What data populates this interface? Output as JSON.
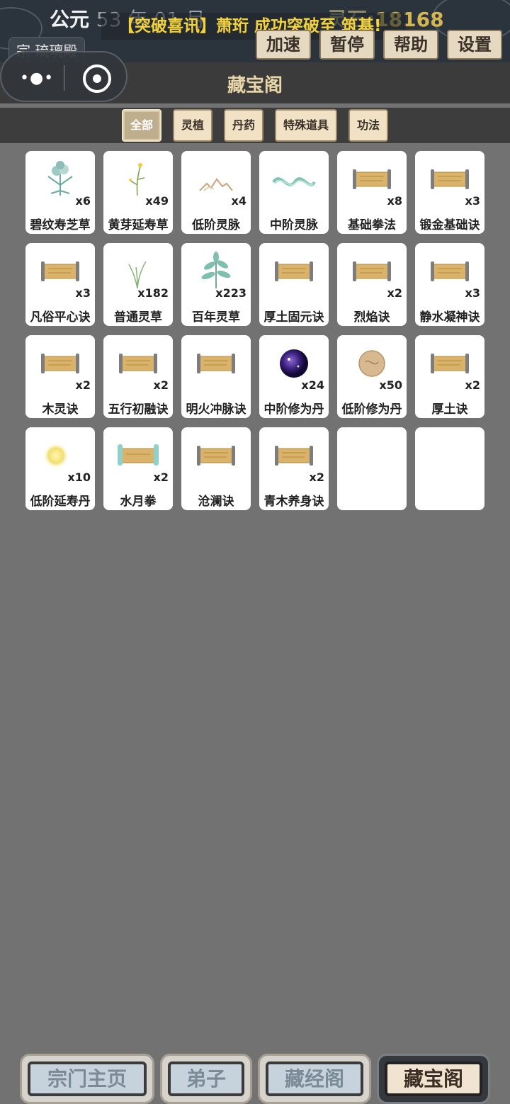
{
  "header": {
    "era_label": "公元",
    "date": "53 年 01 月",
    "stone_label": "灵石:",
    "stone_value": "18168",
    "news": "【突破喜讯】萧珩 成功突破至 筑基!",
    "buttons": [
      "加速",
      "暂停",
      "帮助",
      "设置"
    ],
    "sect": "宗 琉璃殿"
  },
  "capsule": {
    "menu_icon": "more-dots-icon",
    "close_icon": "target-circle-icon"
  },
  "page": {
    "title": "藏宝阁"
  },
  "filters": [
    {
      "label": "全部",
      "active": true
    },
    {
      "label": "灵植",
      "active": false
    },
    {
      "label": "丹药",
      "active": false
    },
    {
      "label": "特殊道具",
      "active": false
    },
    {
      "label": "功法",
      "active": false
    }
  ],
  "items": [
    {
      "name": "碧纹寿芝草",
      "qty": "x6",
      "icon": "herb-blue-icon"
    },
    {
      "name": "黄芽延寿草",
      "qty": "x49",
      "icon": "herb-yellow-icon"
    },
    {
      "name": "低阶灵脉",
      "qty": "x4",
      "icon": "mountain-vein-icon"
    },
    {
      "name": "中阶灵脉",
      "qty": "",
      "icon": "jade-vein-icon"
    },
    {
      "name": "基础拳法",
      "qty": "x8",
      "icon": "scroll-icon"
    },
    {
      "name": "锻金基础诀",
      "qty": "x3",
      "icon": "scroll-icon"
    },
    {
      "name": "凡俗平心诀",
      "qty": "x3",
      "icon": "scroll-icon"
    },
    {
      "name": "普通灵草",
      "qty": "x182",
      "icon": "grass-icon"
    },
    {
      "name": "百年灵草",
      "qty": "x223",
      "icon": "leaf-herb-icon"
    },
    {
      "name": "厚土固元诀",
      "qty": "",
      "icon": "scroll-icon"
    },
    {
      "name": "烈焰诀",
      "qty": "x2",
      "icon": "scroll-icon"
    },
    {
      "name": "静水凝神诀",
      "qty": "x3",
      "icon": "scroll-icon"
    },
    {
      "name": "木灵诀",
      "qty": "x2",
      "icon": "scroll-icon"
    },
    {
      "name": "五行初融诀",
      "qty": "x2",
      "icon": "scroll-icon"
    },
    {
      "name": "明火冲脉诀",
      "qty": "",
      "icon": "scroll-icon"
    },
    {
      "name": "中阶修为丹",
      "qty": "x24",
      "icon": "purple-pill-icon"
    },
    {
      "name": "低阶修为丹",
      "qty": "x50",
      "icon": "tan-pill-icon"
    },
    {
      "name": "厚土诀",
      "qty": "x2",
      "icon": "scroll-icon"
    },
    {
      "name": "低阶延寿丹",
      "qty": "x10",
      "icon": "glow-pill-icon"
    },
    {
      "name": "水月拳",
      "qty": "x2",
      "icon": "jade-scroll-icon"
    },
    {
      "name": "沧澜诀",
      "qty": "",
      "icon": "scroll-icon"
    },
    {
      "name": "青木养身诀",
      "qty": "x2",
      "icon": "scroll-icon"
    },
    {
      "name": "",
      "qty": "",
      "icon": ""
    },
    {
      "name": "",
      "qty": "",
      "icon": ""
    }
  ],
  "nav": [
    {
      "label": "宗门主页",
      "active": false
    },
    {
      "label": "弟子",
      "active": false
    },
    {
      "label": "藏经阁",
      "active": false
    },
    {
      "label": "藏宝阁",
      "active": true
    }
  ]
}
